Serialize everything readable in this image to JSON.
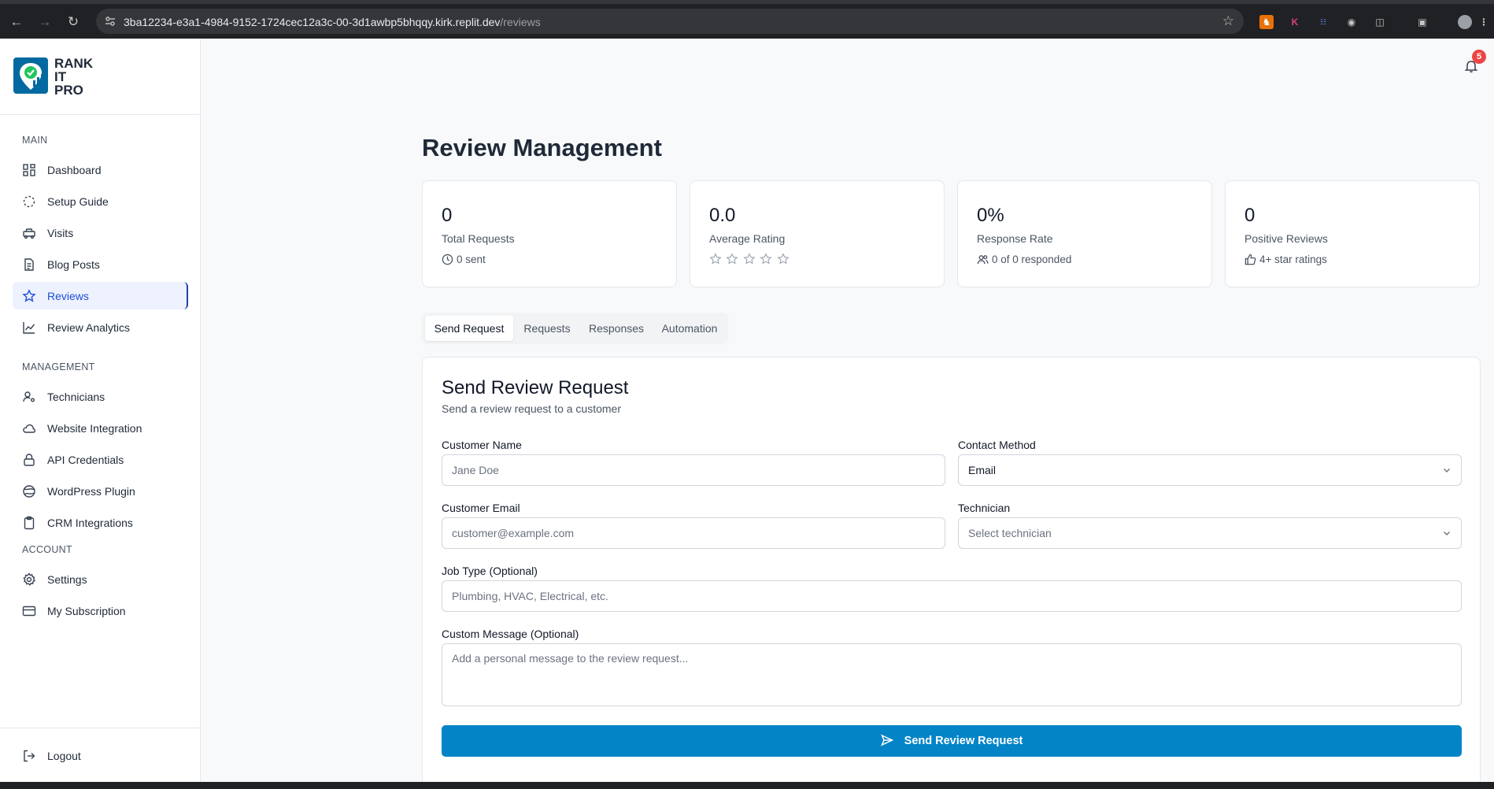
{
  "browser": {
    "url_host": "3ba12234-e3a1-4984-9152-1724cec12a3c-00-3d1awbp5bhqqy.kirk.replit.dev",
    "url_path": "/reviews"
  },
  "brand": {
    "logo_line1": "RANK",
    "logo_line2": "IT",
    "logo_line3": "PRO",
    "accent": "#0284c7",
    "active_nav": "#1d4ed8"
  },
  "sidebar": {
    "main_label": "MAIN",
    "main_items": [
      {
        "label": "Dashboard",
        "icon": "grid-icon"
      },
      {
        "label": "Setup Guide",
        "icon": "loader-icon"
      },
      {
        "label": "Visits",
        "icon": "truck-icon"
      },
      {
        "label": "Blog Posts",
        "icon": "file-text-icon"
      },
      {
        "label": "Reviews",
        "icon": "star-icon",
        "active": true
      },
      {
        "label": "Review Analytics",
        "icon": "line-chart-icon"
      }
    ],
    "management_label": "MANAGEMENT",
    "management_items": [
      {
        "label": "Technicians",
        "icon": "user-cog-icon"
      },
      {
        "label": "Website Integration",
        "icon": "cloud-icon"
      },
      {
        "label": "API Credentials",
        "icon": "lock-icon"
      },
      {
        "label": "WordPress Plugin",
        "icon": "globe-icon"
      },
      {
        "label": "CRM Integrations",
        "icon": "clipboard-icon"
      }
    ],
    "account_label": "ACCOUNT",
    "account_items": [
      {
        "label": "Settings",
        "icon": "gear-icon"
      },
      {
        "label": "My Subscription",
        "icon": "credit-card-icon"
      }
    ],
    "logout_label": "Logout"
  },
  "header": {
    "notification_count": "5"
  },
  "page": {
    "title": "Review Management"
  },
  "stats": [
    {
      "value": "0",
      "caption": "Total Requests",
      "sub": "0 sent",
      "icon": "clock-icon"
    },
    {
      "value": "0.0",
      "caption": "Average Rating",
      "rating": 0,
      "max_rating": 5
    },
    {
      "value": "0%",
      "caption": "Response Rate",
      "sub": "0 of 0 responded",
      "icon": "users-icon"
    },
    {
      "value": "0",
      "caption": "Positive Reviews",
      "sub": "4+ star ratings",
      "icon": "thumbs-up-icon"
    }
  ],
  "tabs": [
    {
      "label": "Send Request",
      "active": true
    },
    {
      "label": "Requests"
    },
    {
      "label": "Responses"
    },
    {
      "label": "Automation"
    }
  ],
  "form": {
    "title": "Send Review Request",
    "description": "Send a review request to a customer",
    "customer_name_label": "Customer Name",
    "customer_name_placeholder": "Jane Doe",
    "contact_method_label": "Contact Method",
    "contact_method_value": "Email",
    "customer_email_label": "Customer Email",
    "customer_email_placeholder": "customer@example.com",
    "technician_label": "Technician",
    "technician_placeholder": "Select technician",
    "job_type_label": "Job Type (Optional)",
    "job_type_placeholder": "Plumbing, HVAC, Electrical, etc.",
    "custom_message_label": "Custom Message (Optional)",
    "custom_message_placeholder": "Add a personal message to the review request...",
    "submit_label": "Send Review Request"
  }
}
